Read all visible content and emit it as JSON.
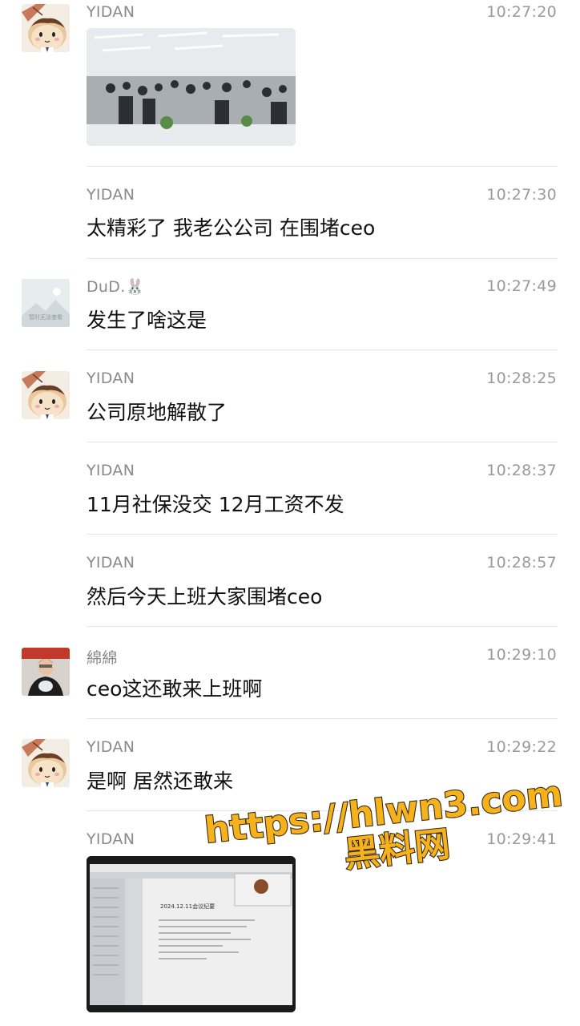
{
  "messages": [
    {
      "sender": "YIDAN",
      "time": "10:27:20",
      "type": "image",
      "image_label": "office crowd photo"
    },
    {
      "sender": "YIDAN",
      "time": "10:27:30",
      "type": "text",
      "text": "太精彩了 我老公公司 在围堵ceo"
    },
    {
      "sender": "DuD.🐰",
      "time": "10:27:49",
      "type": "text",
      "text": "发生了啥这是",
      "avatar_placeholder": "暂时无法查看"
    },
    {
      "sender": "YIDAN",
      "time": "10:28:25",
      "type": "text",
      "text": "公司原地解散了"
    },
    {
      "sender": "YIDAN",
      "time": "10:28:37",
      "type": "text",
      "text": "11月社保没交 12月工资不发"
    },
    {
      "sender": "YIDAN",
      "time": "10:28:57",
      "type": "text",
      "text": "然后今天上班大家围堵ceo"
    },
    {
      "sender": "綿綿",
      "time": "10:29:10",
      "type": "text",
      "text": "ceo这还敢来上班啊"
    },
    {
      "sender": "YIDAN",
      "time": "10:29:22",
      "type": "text",
      "text": "是啊 居然还敢来"
    },
    {
      "sender": "YIDAN",
      "time": "10:29:41",
      "type": "image",
      "image_label": "meeting notes screen photo",
      "doc_title": "2024.12.11会议纪要"
    }
  ],
  "watermark": {
    "line1": "https://hlwn3.com",
    "line2": "黑料网"
  },
  "colors": {
    "name": "#8a8a8a",
    "time": "#9a9a9a",
    "text": "#111111",
    "divider": "#e6e6e6",
    "watermark_fill": "#f5b21d",
    "watermark_stroke": "#3a2a10"
  },
  "icons": [
    "yidan-avatar-icon",
    "rabbit-emoji-icon",
    "image-unavailable-icon",
    "mianmian-avatar-icon"
  ]
}
